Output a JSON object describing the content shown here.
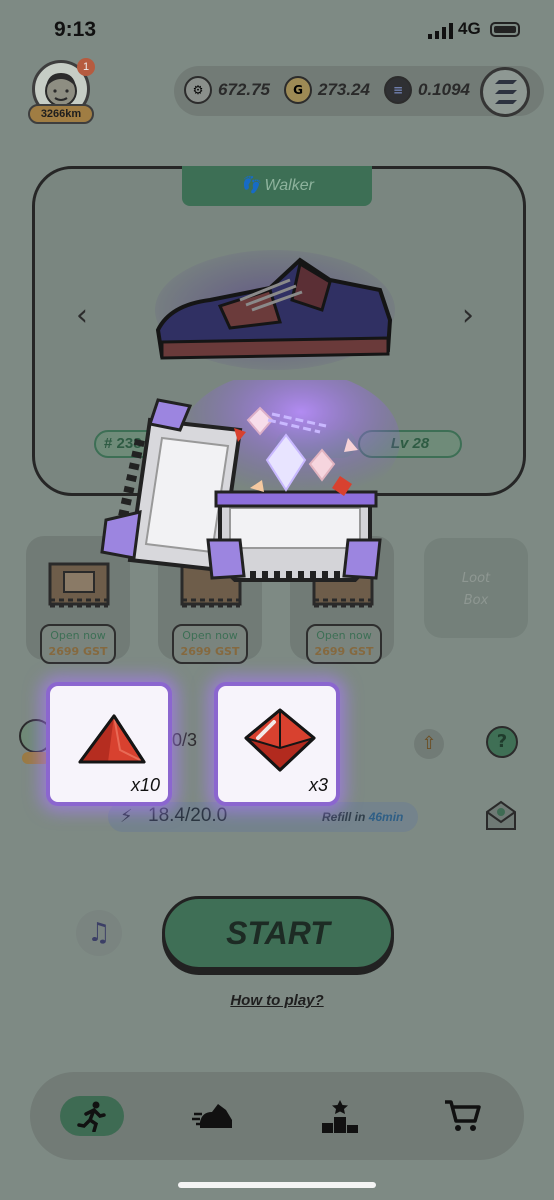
{
  "status_bar": {
    "time": "9:13",
    "network": "4G"
  },
  "profile": {
    "badge_count": "1",
    "distance": "3266km"
  },
  "balances": [
    {
      "icon": "gmt-token-icon",
      "value": "672.75"
    },
    {
      "icon": "gst-token-icon",
      "value": "273.24"
    },
    {
      "icon": "sol-token-icon",
      "value": "0.1094"
    }
  ],
  "sneaker": {
    "type": "Walker",
    "id_prefix": "# 238",
    "level": "Lv 28"
  },
  "loot_boxes": [
    {
      "action": "Open now",
      "cost": "2699 GST"
    },
    {
      "action": "Open now",
      "cost": "2699 GST"
    },
    {
      "action": "Open now",
      "cost": "2699 GST"
    }
  ],
  "loot_empty": {
    "line1": "Loot",
    "line2": "Box"
  },
  "stats": {
    "partial": "0/3"
  },
  "energy": {
    "value": "18.4/20.0",
    "refill_label": "Refill in",
    "refill_time": "46min"
  },
  "actions": {
    "start": "START",
    "how_to": "How to play?"
  },
  "rewards": [
    {
      "gem": "red-triangle-gem-icon",
      "quantity": "x10"
    },
    {
      "gem": "red-octahedron-gem-icon",
      "quantity": "x3"
    }
  ],
  "colors": {
    "accent_green": "#3f6f56",
    "reward_glow": "#8b66cf",
    "gem_red": "#d8412f"
  }
}
